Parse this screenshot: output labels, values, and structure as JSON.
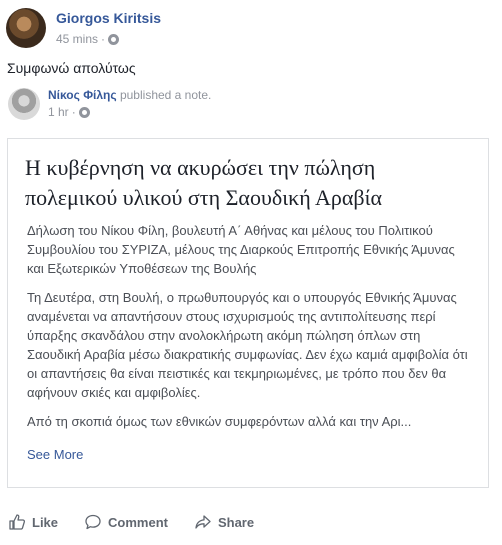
{
  "post": {
    "author": "Giorgos Kiritsis",
    "time": "45 mins",
    "time_separator": "·",
    "text": "Συμφωνώ απολύτως"
  },
  "shared": {
    "author": "Νίκος Φίλης",
    "action": " published a note.",
    "time": "1 hr",
    "time_separator": "·"
  },
  "note": {
    "title": "Η κυβέρνηση να ακυρώσει την πώληση πολεμικού υλικού στη Σαουδική Αραβία",
    "paragraphs": [
      "Δήλωση του Νίκου Φίλη, βουλευτή Α΄ Αθήνας και μέλους του Πολιτικού Συμβουλίου του ΣΥΡΙΖΑ, μέλους της Διαρκούς Επιτροπής Εθνικής Άμυνας και Εξωτερικών Υποθέσεων της Βουλής",
      "Τη Δευτέρα, στη Βουλή, ο πρωθυπουργός και ο υπουργός Εθνικής Άμυνας αναμένεται να απαντήσουν στους ισχυρισμούς της αντιπολίτευσης περί ύπαρξης σκανδάλου στην ανολοκλήρωτη ακόμη πώληση όπλων στη Σαουδική Αραβία μέσω διακρατικής συμφωνίας. Δεν έχω καμιά αμφιβολία ότι οι απαντήσεις θα είναι πειστικές και τεκμηριωμένες, με τρόπο που δεν θα αφήνουν σκιές και αμφιβολίες.",
      "Από τη σκοπιά όμως των εθνικών συμφερόντων αλλά και την Αρι..."
    ],
    "see_more": "See More"
  },
  "actions": {
    "like": "Like",
    "comment": "Comment",
    "share": "Share"
  },
  "colors": {
    "link": "#365899",
    "muted": "#90949c",
    "border": "#dddfe2"
  },
  "icons": {
    "privacy": "globe-icon",
    "like": "thumbs-up-icon",
    "comment": "speech-bubble-icon",
    "share": "share-arrow-icon"
  }
}
